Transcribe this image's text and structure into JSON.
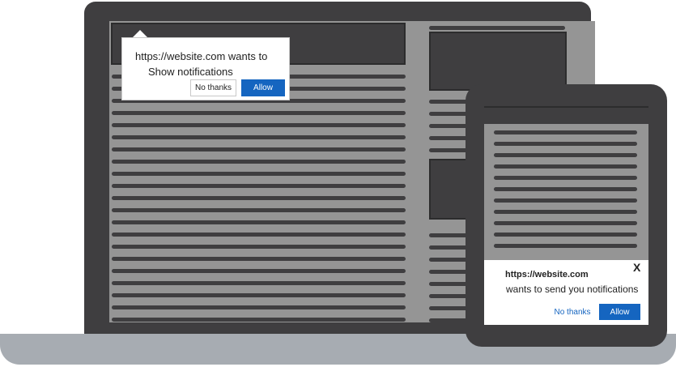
{
  "desktop_prompt": {
    "line1": "https://website.com wants to",
    "line2": "Show notifications",
    "no_thanks_label": "No thanks",
    "allow_label": "Allow"
  },
  "mobile_prompt": {
    "title": "https://website.com",
    "body": "wants to send you notifications",
    "close_label": "X",
    "no_thanks_label": "No thanks",
    "allow_label": "Allow"
  },
  "colors": {
    "device_frame": "#3f3e40",
    "screen_bg": "#959595",
    "laptop_base": "#a7acb2",
    "accent_blue": "#1565c0"
  }
}
